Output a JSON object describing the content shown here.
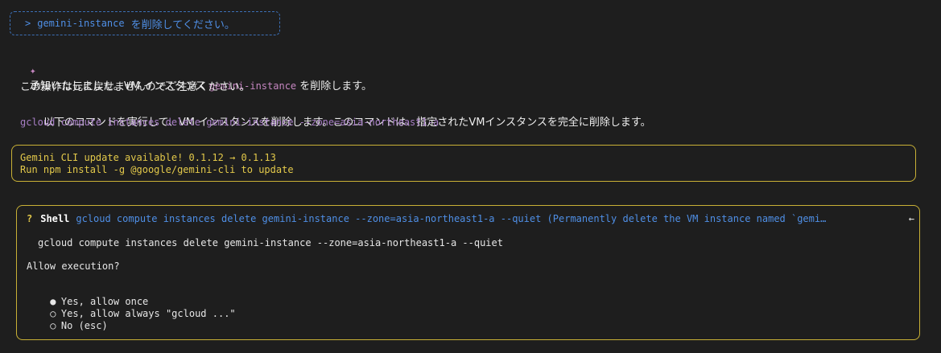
{
  "user_prompt": {
    "symbol": ">",
    "command_name": "gemini-instance",
    "text": "を削除してください。"
  },
  "response": {
    "line1_prefix": "承知いたしました。",
    "line1_vm": "VM",
    "line1_mid": " インスタンス ",
    "line1_code": "gemini-instance",
    "line1_suffix": " を削除します。",
    "line2": "この操作は元に戻せませんのでご注意ください。",
    "line3_prefix": "以下のコマンドを実行して、",
    "line3_vm": "VM",
    "line3_mid": " インスタンスを削除します。このコマンドは、指定された",
    "line3_vm2": "VM",
    "line3_suffix": "インスタンスを完全に削除します。",
    "command": "gcloud compute instances delete gemini-instance --zone=asia-northeast1-a"
  },
  "update_notice": {
    "line1": "Gemini CLI update available! 0.1.12 → 0.1.13",
    "line2": "Run npm install -g @google/gemini-cli to update"
  },
  "shell_confirm": {
    "question_mark": "?",
    "label": "Shell",
    "description": "gcloud compute instances delete gemini-instance --zone=asia-northeast1-a --quiet (Permanently delete the VM instance named `gemi…",
    "arrow": "←",
    "command": "gcloud compute instances delete gemini-instance --zone=asia-northeast1-a --quiet",
    "prompt": "Allow execution?",
    "options": [
      {
        "marker": "●",
        "label": "Yes, allow once"
      },
      {
        "marker": "○",
        "label": "Yes, allow always \"gcloud ...\""
      },
      {
        "marker": "○",
        "label": "No (esc)"
      }
    ]
  },
  "colors": {
    "background": "#1e1e1e",
    "accent_blue": "#4f8fe6",
    "accent_purple": "#c586c0",
    "warning_yellow": "#e3c94a"
  }
}
